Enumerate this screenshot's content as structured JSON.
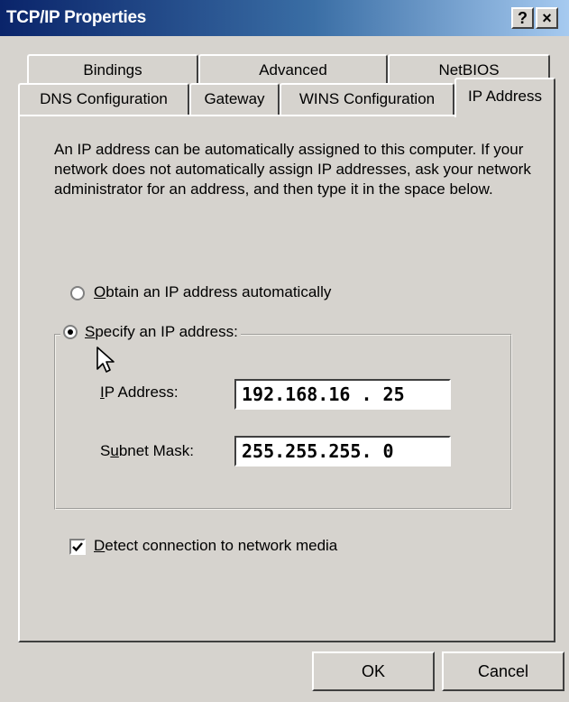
{
  "window": {
    "title": "TCP/IP Properties",
    "help_label": "?",
    "close_label": "×"
  },
  "tabs": {
    "back_row": [
      "Bindings",
      "Advanced",
      "NetBIOS"
    ],
    "front_row": [
      "DNS Configuration",
      "Gateway",
      "WINS Configuration",
      "IP Address"
    ],
    "selected": "IP Address"
  },
  "description": "An IP address can be automatically assigned to this computer. If your network does not automatically assign IP addresses, ask your network administrator for an address, and then type it in the space below.",
  "options": {
    "obtain_auto": {
      "accel": "O",
      "rest": "btain an IP address automatically",
      "selected": false
    },
    "specify": {
      "accel": "S",
      "rest": "pecify an IP address:",
      "selected": true
    }
  },
  "fields": {
    "ip_label_accel": "I",
    "ip_label_rest": "P Address:",
    "ip_value": "192.168.16 . 25",
    "subnet_label_pre": "S",
    "subnet_label_accel": "u",
    "subnet_label_rest": "bnet Mask:",
    "subnet_value": "255.255.255. 0"
  },
  "detect": {
    "accel": "D",
    "rest": "etect connection to network media",
    "checked": true
  },
  "buttons": {
    "ok": "OK",
    "cancel": "Cancel"
  },
  "colors": {
    "face": "#d6d3ce",
    "title_start": "#0a246a",
    "title_end": "#a6caf0"
  }
}
